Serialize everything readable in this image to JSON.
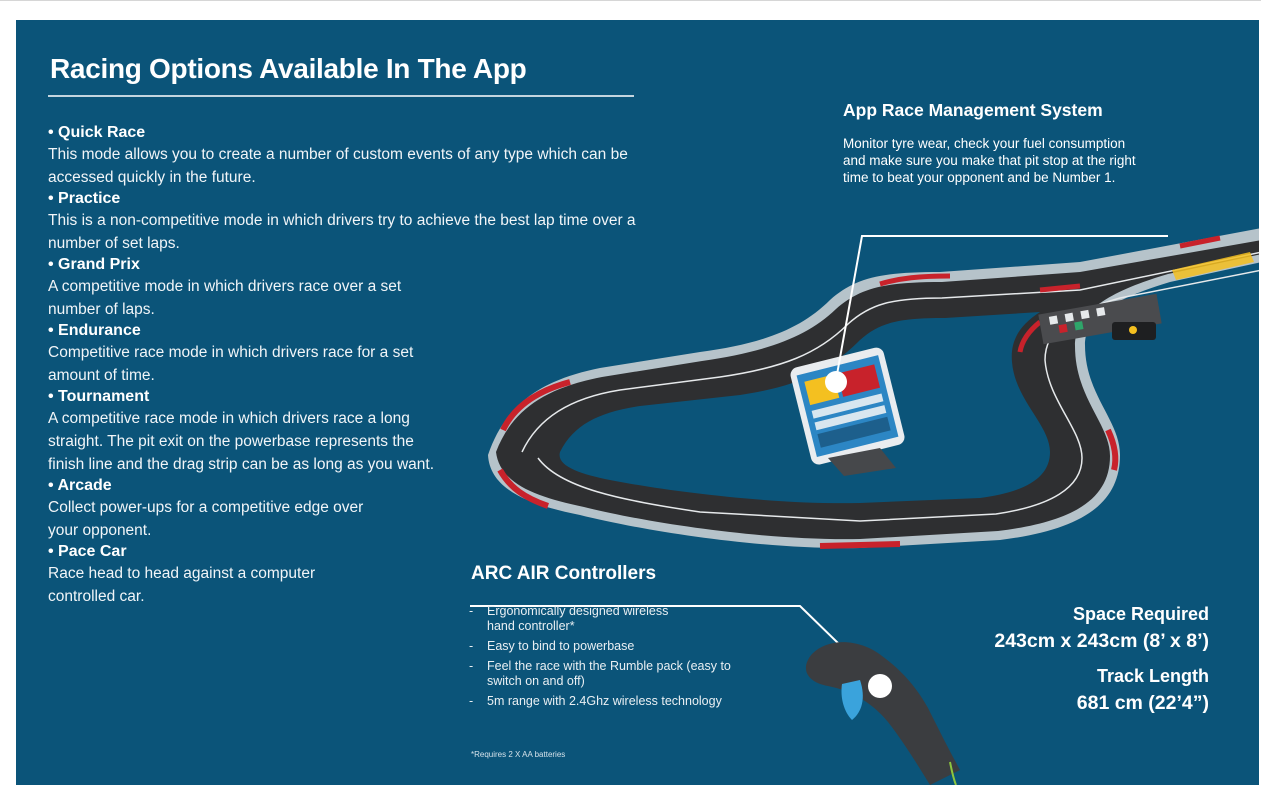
{
  "heading": "Racing Options Available In The App",
  "modes": [
    {
      "name": "• Quick Race",
      "description": "This mode allows you to create a number of custom events of any type which can be accessed quickly in the future."
    },
    {
      "name": "• Practice",
      "description": "This is a non-competitive mode in which drivers try to achieve the best lap time over a number of set laps."
    },
    {
      "name": "• Grand Prix",
      "description": "A competitive mode in which drivers race over a set number of laps."
    },
    {
      "name": "• Endurance",
      "description": "Competitive race mode in which drivers race for a set amount of time."
    },
    {
      "name": "• Tournament",
      "description": "A competitive race mode in which drivers race a long straight. The pit exit on the powerbase represents the finish line and the drag strip can be as long as you want."
    },
    {
      "name": "• Arcade",
      "description": "Collect power-ups for a competitive edge over your opponent."
    },
    {
      "name": "• Pace Car",
      "description": "Race head to head against a computer controlled car."
    }
  ],
  "race_management": {
    "title": "App Race Management System",
    "description": "Monitor tyre wear, check your fuel consumption and make sure you make that pit stop at the right time to beat your opponent and be Number 1."
  },
  "controllers": {
    "title": "ARC AIR Controllers",
    "features": [
      "Ergonomically designed wireless hand controller*",
      "Easy to bind to powerbase",
      "Feel the race with the Rumble pack (easy to switch on and off)",
      "5m range with 2.4Ghz wireless technology"
    ],
    "dash": "-",
    "footnote": "*Requires 2 X AA batteries"
  },
  "specs": {
    "space_label": "Space Required",
    "space_value": "243cm x 243cm (8’ x 8’)",
    "track_label": "Track Length",
    "track_value": "681 cm (22’4”)"
  },
  "colors": {
    "panel": "#0b5479",
    "track_surface": "#2e2f31",
    "kerb_red": "#c8222b",
    "barrier_grey": "#c9cfd3",
    "controller_body": "#3b3d40",
    "controller_trigger": "#3aa3dc"
  }
}
